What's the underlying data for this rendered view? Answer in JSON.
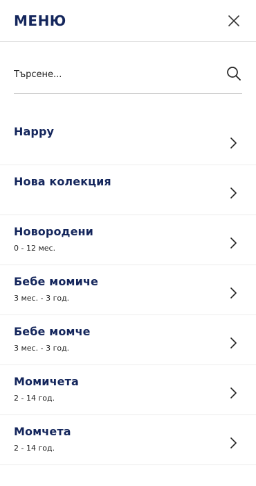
{
  "header": {
    "title": "МЕНЮ",
    "close_icon": "close-icon"
  },
  "search": {
    "placeholder": "Търсене...",
    "value": "",
    "icon": "search-icon"
  },
  "menu": {
    "items": [
      {
        "label": "Happy",
        "sub": ""
      },
      {
        "label": "Нова колекция",
        "sub": ""
      },
      {
        "label": "Новородени",
        "sub": "0 - 12 мес."
      },
      {
        "label": "Бебе момиче",
        "sub": "3 мес. - 3 год."
      },
      {
        "label": "Бебе момче",
        "sub": "3 мес. - 3 год."
      },
      {
        "label": "Момичета",
        "sub": "2 - 14 год."
      },
      {
        "label": "Момчета",
        "sub": "2 - 14 год."
      }
    ],
    "chevron_icon": "chevron-right-icon"
  },
  "colors": {
    "brand_navy": "#14265c",
    "divider": "#ececec"
  }
}
